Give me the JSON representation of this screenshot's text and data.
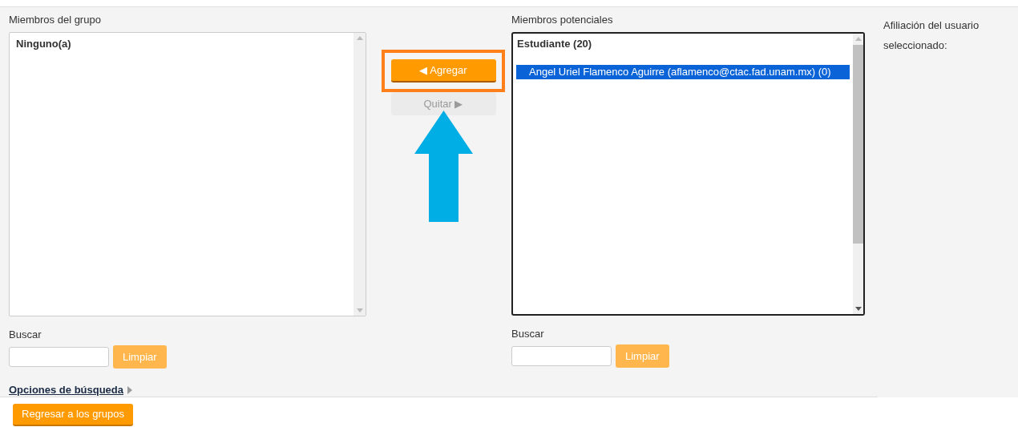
{
  "group_members": {
    "label": "Miembros del grupo",
    "items": [
      {
        "text": "Ninguno(a)",
        "kind": "header"
      }
    ],
    "search": {
      "label": "Buscar",
      "clear_button": "Limpiar"
    }
  },
  "actions": [
    {
      "label": "◀ Agregar",
      "disabled": false,
      "highlighted": true
    },
    {
      "label": "Quitar ▶",
      "disabled": true,
      "highlighted": false
    }
  ],
  "potential_members": {
    "label": "Miembros potenciales",
    "items": [
      {
        "text": "Estudiante (20)",
        "kind": "header"
      },
      {
        "text": "Angel Uriel Flamenco Aguirre (aflamenco@ctac.fad.unam.mx) (0)",
        "kind": "option",
        "selected": true
      }
    ],
    "search": {
      "label": "Buscar",
      "clear_button": "Limpiar"
    }
  },
  "affiliation": {
    "label": "Afiliación del usuario seleccionado:"
  },
  "search_options_link": "Opciones de búsqueda",
  "back_button": "Regresar a los grupos"
}
